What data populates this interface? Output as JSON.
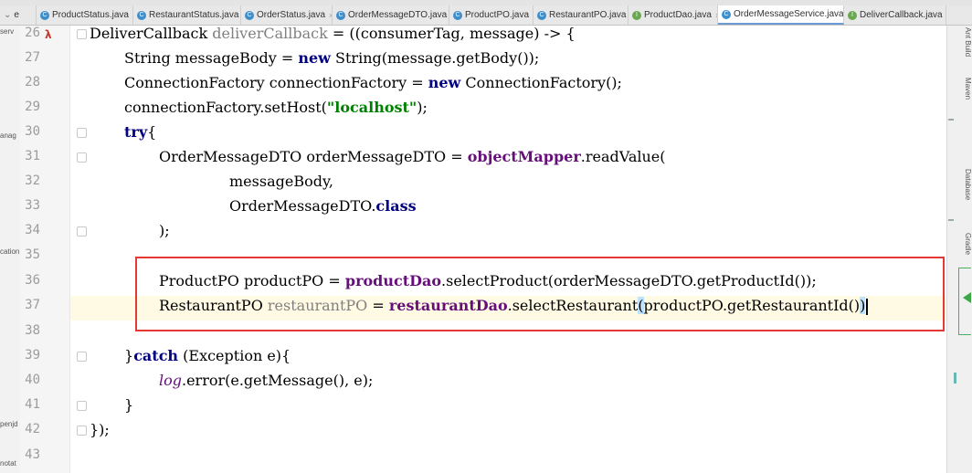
{
  "tabs": [
    {
      "label": "e",
      "icon": "",
      "overflow": true
    },
    {
      "label": "ProductStatus.java",
      "icon": "class-icon"
    },
    {
      "label": "RestaurantStatus.java",
      "icon": "class-icon"
    },
    {
      "label": "OrderStatus.java",
      "icon": "class-icon"
    },
    {
      "label": "OrderMessageDTO.java",
      "icon": "class-icon"
    },
    {
      "label": "ProductPO.java",
      "icon": "class-icon"
    },
    {
      "label": "RestaurantPO.java",
      "icon": "class-icon"
    },
    {
      "label": "ProductDao.java",
      "icon": "interface-icon"
    },
    {
      "label": "OrderMessageService.java",
      "icon": "class-icon",
      "active": true
    },
    {
      "label": "DeliverCallback.java",
      "icon": "interface-icon"
    }
  ],
  "left_panel_labels": [
    "serv",
    "anag",
    "cation",
    "penjd",
    "notat"
  ],
  "right_panel_labels": [
    "Ant Build",
    "Maven",
    "Database",
    "Gradle"
  ],
  "editor": {
    "line_numbers": [
      "26",
      "27",
      "28",
      "29",
      "30",
      "31",
      "32",
      "33",
      "34",
      "35",
      "36",
      "37",
      "38",
      "39",
      "40",
      "41",
      "42",
      "43"
    ],
    "lambda_marker": "λ",
    "code": {
      "l26_a": "DeliverCallback ",
      "l26_b": "deliverCallback",
      "l26_c": " = ((consumerTag, message) -> {",
      "l27_a": "String messageBody = ",
      "l27_kw": "new",
      "l27_b": " String(message.getBody());",
      "l28_a": "ConnectionFactory connectionFactory = ",
      "l28_kw": "new",
      "l28_b": " ConnectionFactory();",
      "l29_a": "connectionFactory.setHost(",
      "l29_str": "\"localhost\"",
      "l29_b": ");",
      "l30_kw": "try",
      "l30_b": "{",
      "l31_a": "OrderMessageDTO orderMessageDTO = ",
      "l31_fld": "objectMapper",
      "l31_b": ".readValue(",
      "l32": "messageBody,",
      "l33_a": "OrderMessageDTO.",
      "l33_kw": "class",
      "l34": ");",
      "l36_a": "ProductPO productPO = ",
      "l36_fld": "productDao",
      "l36_b": ".selectProduct(orderMessageDTO.getProductId());",
      "l37_a": "RestaurantPO ",
      "l37_unused": "restaurantPO",
      "l37_b": " = ",
      "l37_fld": "restaurantDao",
      "l37_c": ".selectRestaurant",
      "l37_open": "(",
      "l37_d": "productPO.getRestaurantId()",
      "l37_close": ")",
      "l39_a": "}",
      "l39_kw": "catch",
      "l39_b": " (Exception e){",
      "l40_ital": "log",
      "l40_b": ".error(e.getMessage(), e);",
      "l41": "}",
      "l42": "});"
    }
  }
}
